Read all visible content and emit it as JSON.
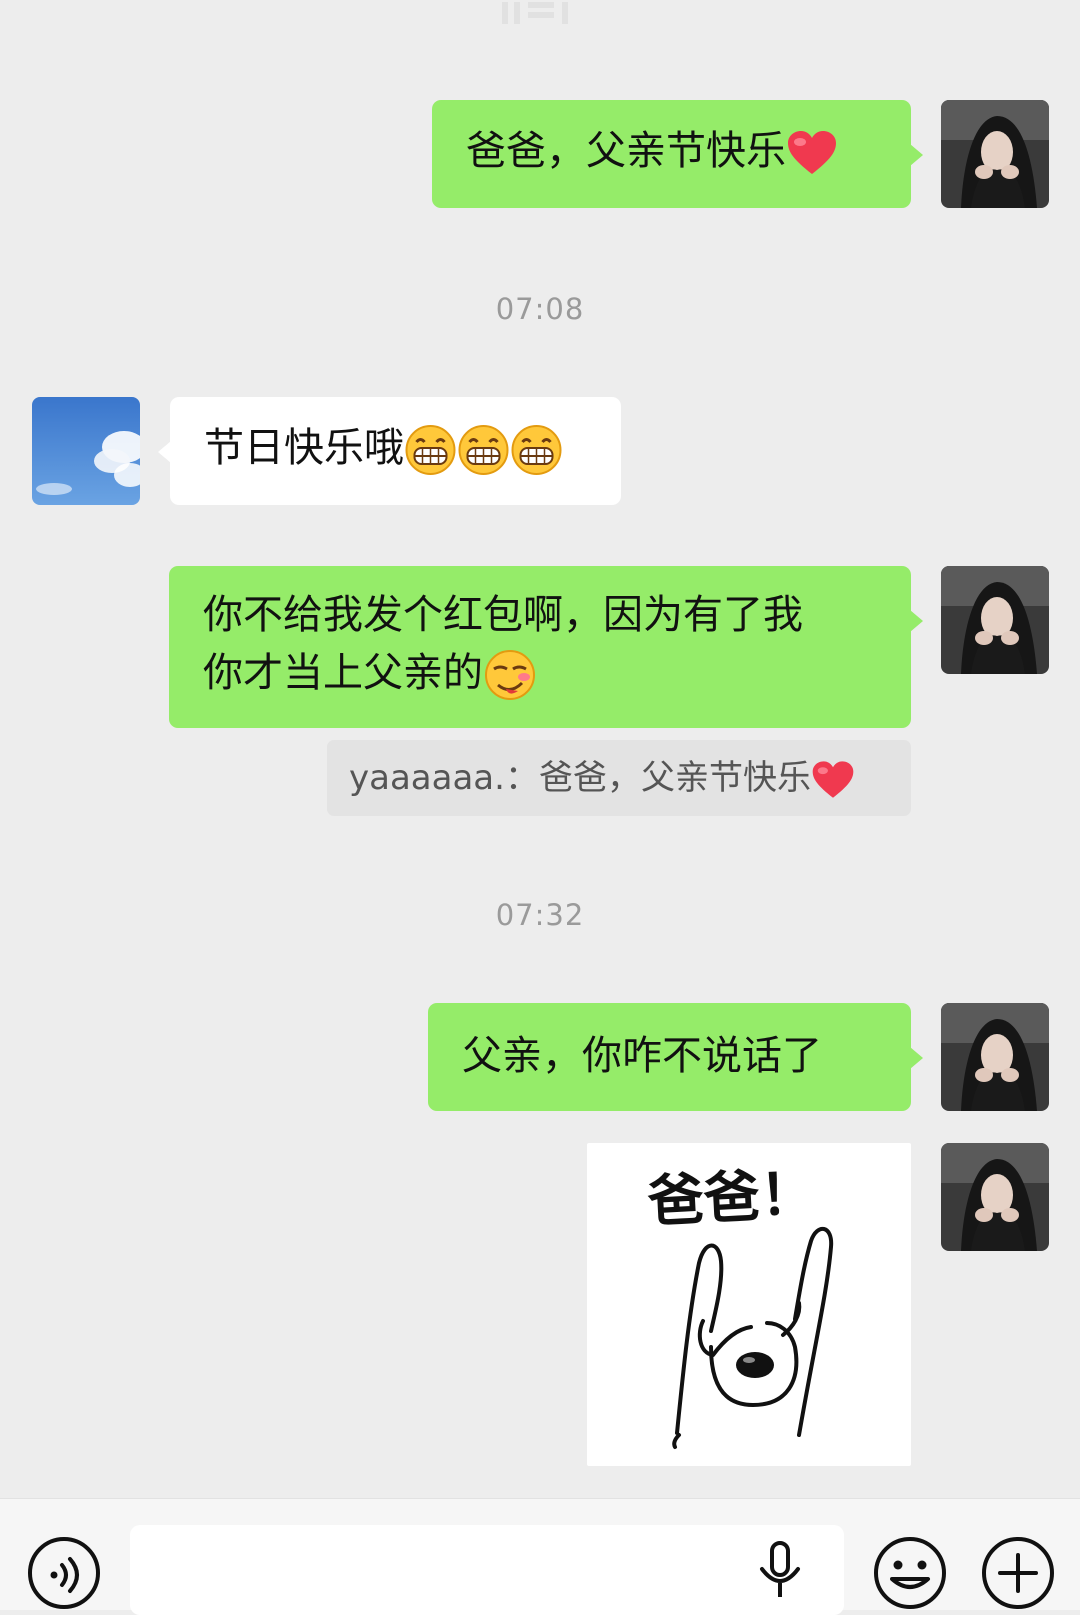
{
  "messages": [
    {
      "kind": "text",
      "side": "right",
      "text": "爸爸，父亲节快乐",
      "emoji": "heart-emoji"
    },
    {
      "kind": "timestamp",
      "text": "07:08"
    },
    {
      "kind": "text",
      "side": "left",
      "text": "节日快乐哦",
      "emoji": "grin-emoji x3"
    },
    {
      "kind": "text",
      "side": "right",
      "line1": "你不给我发个红包啊，因为有了我",
      "line2": "你才当上父亲的",
      "emoji": "smirk-emoji",
      "quote": {
        "sender": "yaaaaaa.",
        "separator": "：",
        "text": "爸爸，父亲节快乐"
      }
    },
    {
      "kind": "timestamp",
      "text": "07:32"
    },
    {
      "kind": "text",
      "side": "right",
      "text": "父亲，你咋不说话了"
    },
    {
      "kind": "sticker",
      "side": "right",
      "caption": "爸爸！",
      "image": "puppy-raising-arms-sticker"
    }
  ],
  "colors": {
    "background": "#ededed",
    "sent_bubble": "#95ec69",
    "received_bubble": "#ffffff",
    "quote_background": "#e3e3e3",
    "timestamp": "#9a9a9a"
  },
  "input_bar": {
    "voice_button": "voice-mode-icon",
    "mic_icon": "microphone-icon",
    "emoji_button": "smiley-icon",
    "more_button": "plus-icon"
  }
}
